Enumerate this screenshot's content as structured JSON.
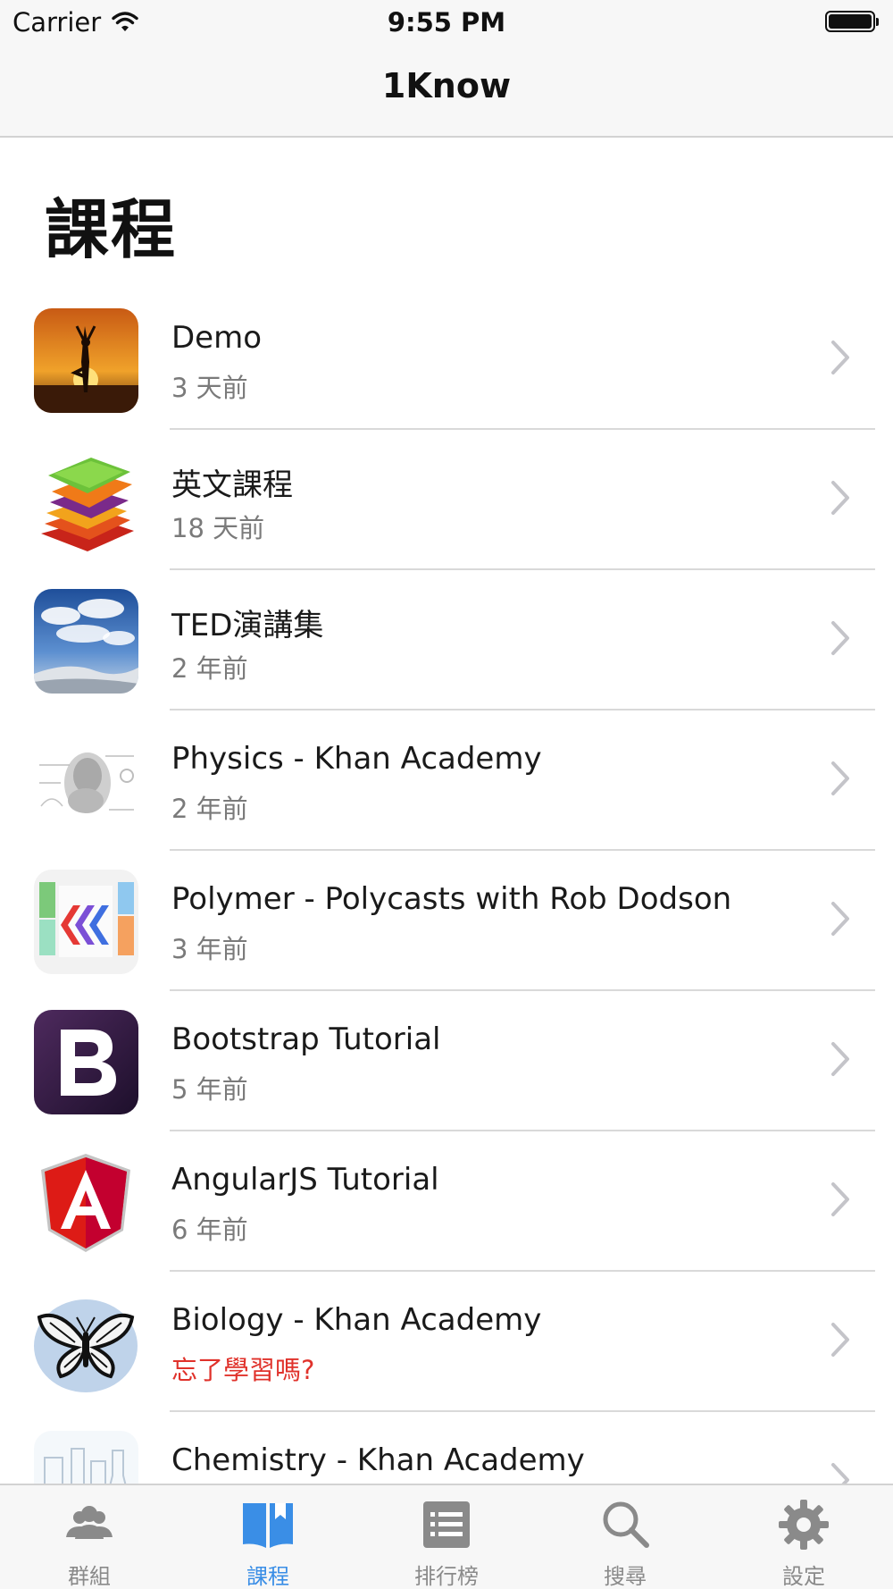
{
  "status_bar": {
    "carrier": "Carrier",
    "time": "9:55 PM"
  },
  "nav": {
    "title": "1Know"
  },
  "page": {
    "large_title": "課程"
  },
  "courses": [
    {
      "title": "Demo",
      "subtitle": "3 天前",
      "alert": false,
      "icon": "yoga-sunset-thumbnail"
    },
    {
      "title": "英文課程",
      "subtitle": "18 天前",
      "alert": false,
      "icon": "colorful-layers-thumbnail"
    },
    {
      "title": "TED演講集",
      "subtitle": "2 年前",
      "alert": false,
      "icon": "sky-clouds-thumbnail"
    },
    {
      "title": "Physics - Khan Academy",
      "subtitle": "2 年前",
      "alert": false,
      "icon": "physics-sketch-thumbnail"
    },
    {
      "title": "Polymer - Polycasts with Rob Dodson",
      "subtitle": "3 年前",
      "alert": false,
      "icon": "polymer-logo-thumbnail"
    },
    {
      "title": "Bootstrap Tutorial",
      "subtitle": "5 年前",
      "alert": false,
      "icon": "bootstrap-logo-thumbnail"
    },
    {
      "title": "AngularJS Tutorial",
      "subtitle": "6 年前",
      "alert": false,
      "icon": "angular-logo-thumbnail"
    },
    {
      "title": "Biology - Khan Academy",
      "subtitle": "忘了學習嗎?",
      "alert": true,
      "icon": "butterfly-thumbnail"
    },
    {
      "title": "Chemistry - Khan Academy",
      "subtitle": "",
      "alert": false,
      "icon": "lab-glassware-thumbnail"
    }
  ],
  "tabs": [
    {
      "label": "群組",
      "icon": "group-icon",
      "active": false
    },
    {
      "label": "課程",
      "icon": "book-icon",
      "active": true
    },
    {
      "label": "排行榜",
      "icon": "leaderboard-icon",
      "active": false
    },
    {
      "label": "搜尋",
      "icon": "search-icon",
      "active": false
    },
    {
      "label": "設定",
      "icon": "gear-icon",
      "active": false
    }
  ],
  "colors": {
    "accent": "#3a8ee6",
    "alert": "#e0322b",
    "inactive": "#8a8a8a"
  }
}
